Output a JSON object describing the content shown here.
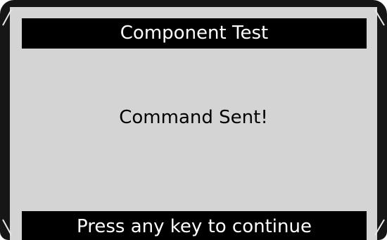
{
  "screen": {
    "title": "Component Test",
    "message": "Command Sent!",
    "footer": "Press any key to continue"
  },
  "colors": {
    "bezel": "#161616",
    "screen_background": "#d4d4d4",
    "bar_background": "#000000",
    "bar_text": "#ffffff",
    "body_text": "#000000"
  }
}
